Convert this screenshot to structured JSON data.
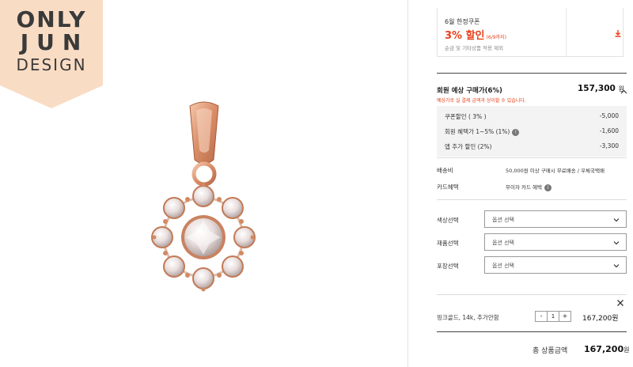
{
  "brand": {
    "line1": "ONLY",
    "line2": "JUN",
    "line3": "DESIGN",
    "banner_color": "#f9dcc4"
  },
  "product_image": {
    "icon": "rose-gold-flower-pendant"
  },
  "coupon": {
    "title": "6월 한정쿠폰",
    "headline": "3% 할인",
    "headline_small": "(6/9까지)",
    "note": "순금 및 기타상품 적용 제외",
    "download_icon": "download-icon",
    "accent_color": "#e8411a"
  },
  "member_price": {
    "title": "회원 예상 구매가(6%)",
    "price": "157,300",
    "unit": "원",
    "note": "예상가로 실 결제 금액과 상이할 수 있습니다.",
    "discounts": [
      {
        "label": "쿠폰할인 ( 3% )",
        "amount": "-5,000",
        "has_info": false
      },
      {
        "label": "회원 혜택가 1~5% (1%)",
        "amount": "-1,600",
        "has_info": true
      },
      {
        "label": "앱 추가 할인 (2%)",
        "amount": "-3,300",
        "has_info": false
      }
    ]
  },
  "info": {
    "shipping_label": "배송비",
    "shipping_value": "50,000원 이상 구매시 무료배송 / 우체국택배",
    "card_label": "카드혜택",
    "card_value": "무이자 카드 혜택"
  },
  "options": [
    {
      "label": "색상선택",
      "value": "옵션 선택"
    },
    {
      "label": "재품선택",
      "value": "옵션 선택"
    },
    {
      "label": "포장선택",
      "value": "옵션 선택"
    }
  ],
  "selected_item": {
    "name": "핑크골드, 14k, 추가안함",
    "minus": "-",
    "quantity": "1",
    "plus": "+",
    "price": "167,200원"
  },
  "total": {
    "label": "총 상품금액",
    "price": "167,200",
    "unit": "원"
  }
}
